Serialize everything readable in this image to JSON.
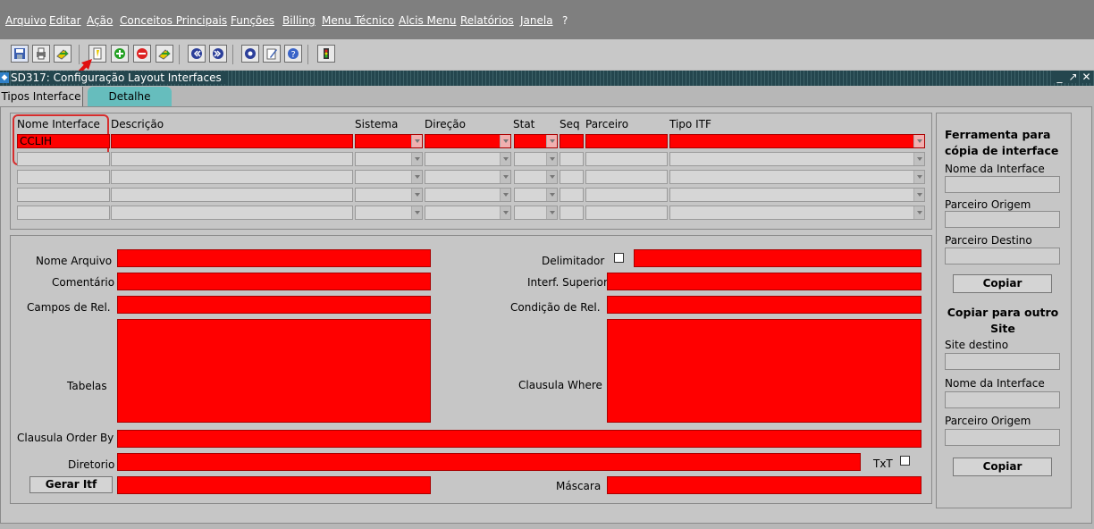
{
  "menu": [
    "Arquivo",
    "Editar",
    "Ação",
    "Conceitos Principais",
    "Funções",
    "Billing",
    "Menu Técnico",
    "Alcis Menu",
    "Relatórios",
    "Janela",
    "?"
  ],
  "window": {
    "title": "SD317: Configuração Layout Interfaces",
    "icon": "window-icon"
  },
  "tabs": [
    {
      "label": "Tipos Interface",
      "active": true
    },
    {
      "label": "Detalhe",
      "active": false
    }
  ],
  "grid": {
    "headers": [
      "Nome Interface",
      "Descrição",
      "Sistema",
      "Direção",
      "Stat",
      "Seq",
      "Parceiro",
      "Tipo ITF"
    ],
    "first_row_name": "CCLIH"
  },
  "detail": {
    "nome_arquivo": "Nome Arquivo",
    "comentario": "Comentário",
    "campos_rel": "Campos de Rel.",
    "tabelas": "Tabelas",
    "clausula_order": "Clausula Order By",
    "diretorio": "Diretorio",
    "gerar_itf": "Gerar Itf",
    "delimitador": "Delimitador",
    "interf_superior": "Interf. Superior",
    "condicao_rel": "Condição de Rel.",
    "clausula_where": "Clausula Where",
    "txt": "TxT",
    "mascara": "Máscara"
  },
  "side": {
    "title1": "Ferramenta para cópia de interface",
    "nome_interface": "Nome da Interface",
    "parceiro_origem": "Parceiro Origem",
    "parceiro_destino": "Parceiro Destino",
    "copiar": "Copiar",
    "title2": "Copiar para outro Site",
    "site_destino": "Site destino",
    "nome_interface2": "Nome da Interface",
    "parceiro_origem2": "Parceiro Origem",
    "copiar2": "Copiar"
  },
  "colors": {
    "required": "#ff0000",
    "highlight": "#d62d2d",
    "tab_active_bg": "#66bdbd"
  }
}
